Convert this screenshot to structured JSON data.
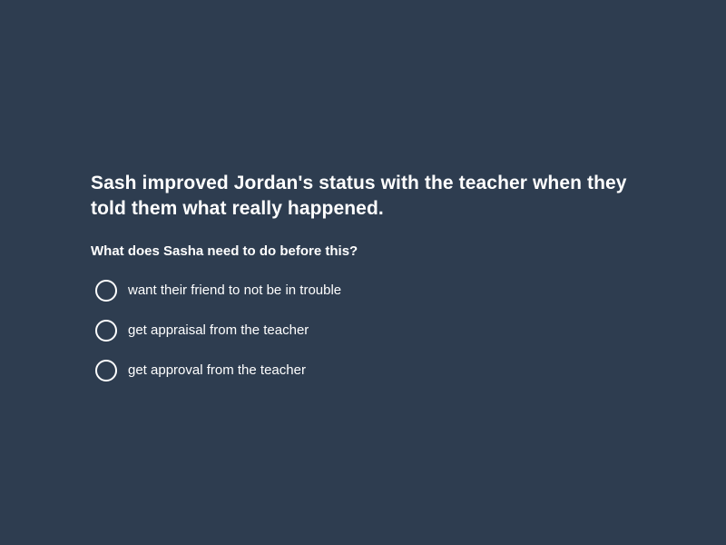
{
  "context": "Sash improved Jordan's status with the teacher when they told them what really happened.",
  "question": "What does Sasha need to do before this?",
  "options": [
    {
      "label": "want their friend to not be in trouble"
    },
    {
      "label": "get appraisal from the teacher"
    },
    {
      "label": "get approval from the teacher"
    }
  ]
}
